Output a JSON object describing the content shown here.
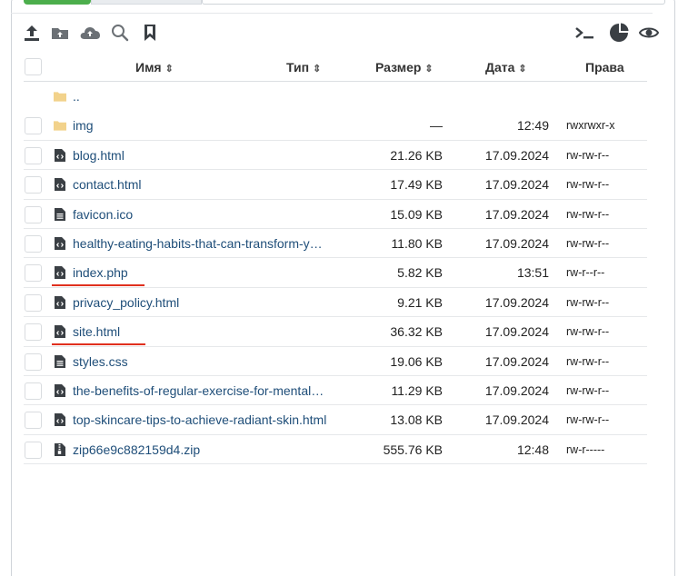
{
  "toolbar": {
    "left_icons": [
      "upload-icon",
      "new-folder-icon",
      "cloud-upload-icon",
      "search-icon",
      "bookmark-icon"
    ],
    "right_icons": [
      "terminal-icon",
      "disk-usage-icon",
      "view-icon"
    ]
  },
  "columns": {
    "name": "Имя",
    "type": "Тип",
    "size": "Размер",
    "date": "Дата",
    "perms": "Права",
    "sort_glyph": "⇕"
  },
  "rows": [
    {
      "name": "..",
      "kind": "folder",
      "size": "",
      "date": "",
      "perms": "",
      "checkbox": false
    },
    {
      "name": "img",
      "kind": "folder",
      "size": "—",
      "date": "12:49",
      "perms": "rwxrwxr-x",
      "checkbox": true
    },
    {
      "name": "blog.html",
      "kind": "code",
      "size": "21.26 KB",
      "date": "17.09.2024",
      "perms": "rw-rw-r--",
      "checkbox": true
    },
    {
      "name": "contact.html",
      "kind": "code",
      "size": "17.49 KB",
      "date": "17.09.2024",
      "perms": "rw-rw-r--",
      "checkbox": true
    },
    {
      "name": "favicon.ico",
      "kind": "file",
      "size": "15.09 KB",
      "date": "17.09.2024",
      "perms": "rw-rw-r--",
      "checkbox": true
    },
    {
      "name": "healthy-eating-habits-that-can-transform-y…",
      "kind": "code",
      "size": "11.80 KB",
      "date": "17.09.2024",
      "perms": "rw-rw-r--",
      "checkbox": true
    },
    {
      "name": "index.php",
      "kind": "code",
      "size": "5.82 KB",
      "date": "13:51",
      "perms": "rw-r--r--",
      "checkbox": true,
      "underline": true
    },
    {
      "name": "privacy_policy.html",
      "kind": "code",
      "size": "9.21 KB",
      "date": "17.09.2024",
      "perms": "rw-rw-r--",
      "checkbox": true
    },
    {
      "name": "site.html",
      "kind": "code",
      "size": "36.32 KB",
      "date": "17.09.2024",
      "perms": "rw-rw-r--",
      "checkbox": true,
      "underline": true
    },
    {
      "name": "styles.css",
      "kind": "file",
      "size": "19.06 KB",
      "date": "17.09.2024",
      "perms": "rw-rw-r--",
      "checkbox": true
    },
    {
      "name": "the-benefits-of-regular-exercise-for-mental…",
      "kind": "code",
      "size": "11.29 KB",
      "date": "17.09.2024",
      "perms": "rw-rw-r--",
      "checkbox": true
    },
    {
      "name": "top-skincare-tips-to-achieve-radiant-skin.html",
      "kind": "code",
      "size": "13.08 KB",
      "date": "17.09.2024",
      "perms": "rw-rw-r--",
      "checkbox": true
    },
    {
      "name": "zip66e9c882159d4.zip",
      "kind": "zip",
      "size": "555.76 KB",
      "date": "12:48",
      "perms": "rw-r-----",
      "checkbox": true
    }
  ],
  "colors": {
    "accent_tab": "#4cae4c",
    "link": "#1f4e79",
    "folder": "#f2d28b",
    "icon": "#3a3f44",
    "highlight_underline": "#e0301e"
  }
}
